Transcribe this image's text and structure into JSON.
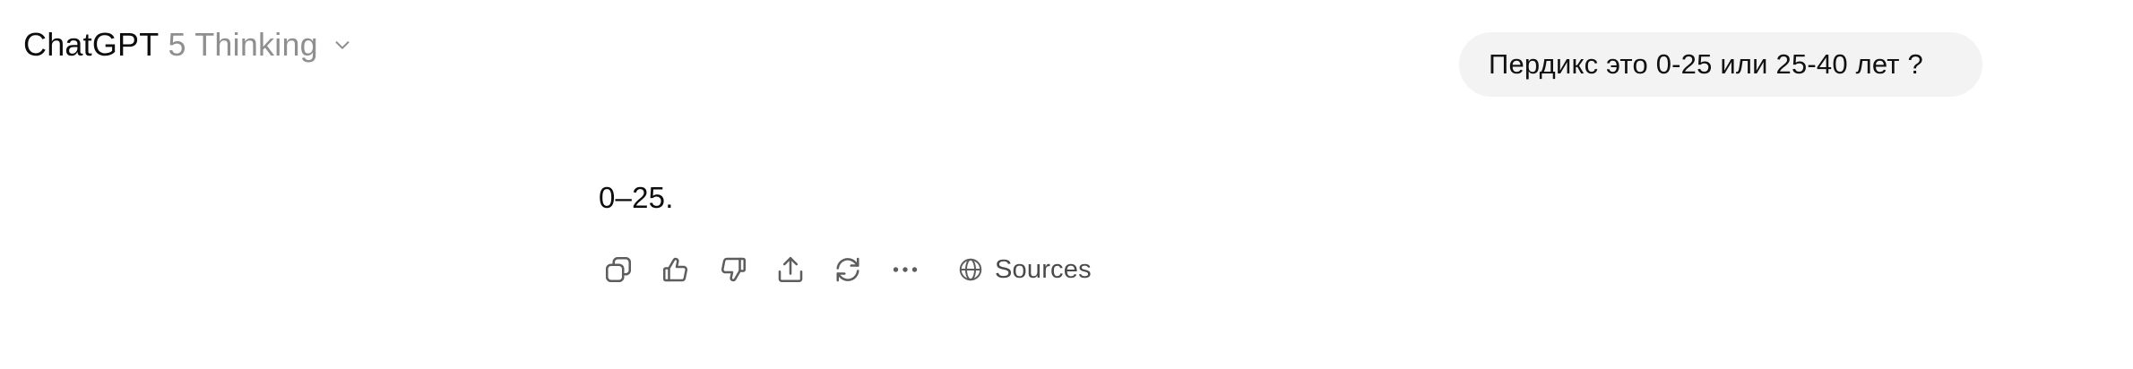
{
  "header": {
    "model_name": "ChatGPT",
    "model_variant": "5 Thinking",
    "chevron_icon": "chevron-down-icon"
  },
  "conversation": {
    "user_message": "Пердикс это 0-25 или 25-40 лет ?",
    "assistant_message": "0–25."
  },
  "actions": {
    "icons": [
      "copy-icon",
      "thumbs-up-icon",
      "thumbs-down-icon",
      "share-icon",
      "regenerate-icon",
      "more-icon",
      "globe-icon"
    ],
    "sources_label": "Sources"
  },
  "colors": {
    "text": "#0d0d0d",
    "muted": "#8f8f8f",
    "bubble": "#f3f3f3",
    "icon": "#5d5d5d"
  }
}
